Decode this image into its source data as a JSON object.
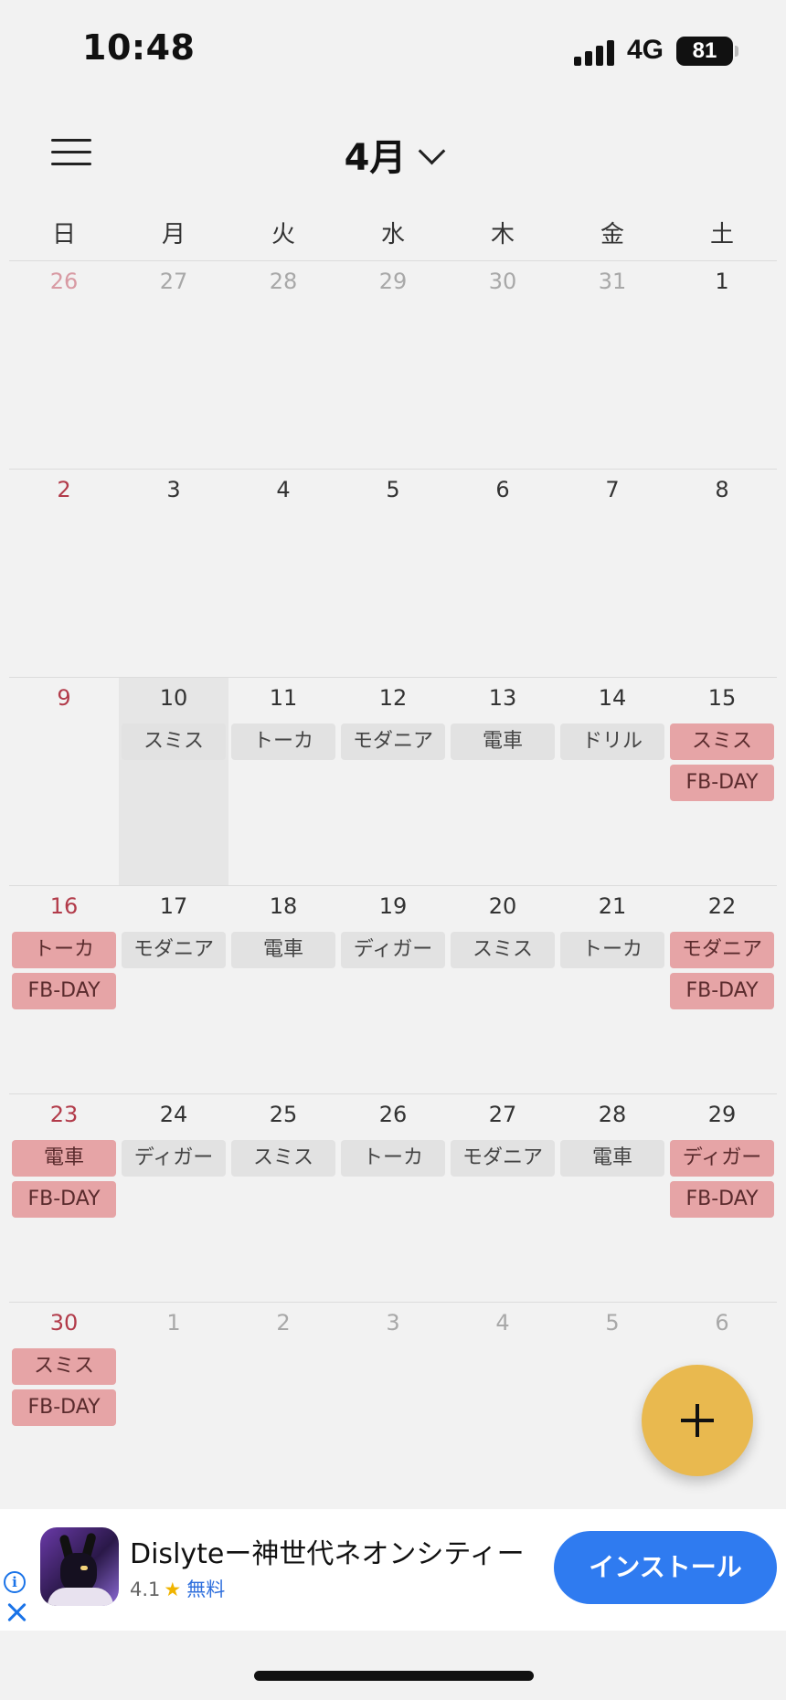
{
  "status_bar": {
    "time": "10:48",
    "network": "4G",
    "battery": "81"
  },
  "header": {
    "month_label": "4月"
  },
  "weekdays": [
    "日",
    "月",
    "火",
    "水",
    "木",
    "金",
    "土"
  ],
  "calendar": {
    "weeks": [
      [
        {
          "day": "26",
          "other": true,
          "events": []
        },
        {
          "day": "27",
          "other": true,
          "events": []
        },
        {
          "day": "28",
          "other": true,
          "events": []
        },
        {
          "day": "29",
          "other": true,
          "events": []
        },
        {
          "day": "30",
          "other": true,
          "events": []
        },
        {
          "day": "31",
          "other": true,
          "events": []
        },
        {
          "day": "1",
          "events": []
        }
      ],
      [
        {
          "day": "2",
          "events": []
        },
        {
          "day": "3",
          "events": []
        },
        {
          "day": "4",
          "events": []
        },
        {
          "day": "5",
          "events": []
        },
        {
          "day": "6",
          "events": []
        },
        {
          "day": "7",
          "events": []
        },
        {
          "day": "8",
          "events": []
        }
      ],
      [
        {
          "day": "9",
          "events": []
        },
        {
          "day": "10",
          "today": true,
          "events": [
            {
              "label": "スミス",
              "style": "gray"
            }
          ]
        },
        {
          "day": "11",
          "events": [
            {
              "label": "トーカ",
              "style": "gray"
            }
          ]
        },
        {
          "day": "12",
          "events": [
            {
              "label": "モダニア",
              "style": "gray"
            }
          ]
        },
        {
          "day": "13",
          "events": [
            {
              "label": "電車",
              "style": "gray"
            }
          ]
        },
        {
          "day": "14",
          "events": [
            {
              "label": "ドリル",
              "style": "gray"
            }
          ]
        },
        {
          "day": "15",
          "events": [
            {
              "label": "スミス",
              "style": "red"
            },
            {
              "label": "FB-DAY",
              "style": "red"
            }
          ]
        }
      ],
      [
        {
          "day": "16",
          "events": [
            {
              "label": "トーカ",
              "style": "red"
            },
            {
              "label": "FB-DAY",
              "style": "red"
            }
          ]
        },
        {
          "day": "17",
          "events": [
            {
              "label": "モダニア",
              "style": "gray"
            }
          ]
        },
        {
          "day": "18",
          "events": [
            {
              "label": "電車",
              "style": "gray"
            }
          ]
        },
        {
          "day": "19",
          "events": [
            {
              "label": "ディガー",
              "style": "gray"
            }
          ]
        },
        {
          "day": "20",
          "events": [
            {
              "label": "スミス",
              "style": "gray"
            }
          ]
        },
        {
          "day": "21",
          "events": [
            {
              "label": "トーカ",
              "style": "gray"
            }
          ]
        },
        {
          "day": "22",
          "events": [
            {
              "label": "モダニア",
              "style": "red"
            },
            {
              "label": "FB-DAY",
              "style": "red"
            }
          ]
        }
      ],
      [
        {
          "day": "23",
          "events": [
            {
              "label": "電車",
              "style": "red"
            },
            {
              "label": "FB-DAY",
              "style": "red"
            }
          ]
        },
        {
          "day": "24",
          "events": [
            {
              "label": "ディガー",
              "style": "gray"
            }
          ]
        },
        {
          "day": "25",
          "events": [
            {
              "label": "スミス",
              "style": "gray"
            }
          ]
        },
        {
          "day": "26",
          "events": [
            {
              "label": "トーカ",
              "style": "gray"
            }
          ]
        },
        {
          "day": "27",
          "events": [
            {
              "label": "モダニア",
              "style": "gray"
            }
          ]
        },
        {
          "day": "28",
          "events": [
            {
              "label": "電車",
              "style": "gray"
            }
          ]
        },
        {
          "day": "29",
          "events": [
            {
              "label": "ディガー",
              "style": "red"
            },
            {
              "label": "FB-DAY",
              "style": "red"
            }
          ]
        }
      ],
      [
        {
          "day": "30",
          "events": [
            {
              "label": "スミス",
              "style": "red"
            },
            {
              "label": "FB-DAY",
              "style": "red"
            }
          ]
        },
        {
          "day": "1",
          "other": true,
          "events": []
        },
        {
          "day": "2",
          "other": true,
          "events": []
        },
        {
          "day": "3",
          "other": true,
          "events": []
        },
        {
          "day": "4",
          "other": true,
          "events": []
        },
        {
          "day": "5",
          "other": true,
          "events": []
        },
        {
          "day": "6",
          "other": true,
          "events": []
        }
      ]
    ]
  },
  "ad": {
    "title": "Dislyteー神世代ネオンシティー",
    "rating": "4.1",
    "price": "無料",
    "install_label": "インストール",
    "info_glyph": "i"
  },
  "colors": {
    "accent_fab": "#e9b94f",
    "event_red": "#e6a4a6",
    "event_gray": "#e2e2e2",
    "sunday_text": "#b23b4a",
    "install_blue": "#2f7bf0"
  }
}
